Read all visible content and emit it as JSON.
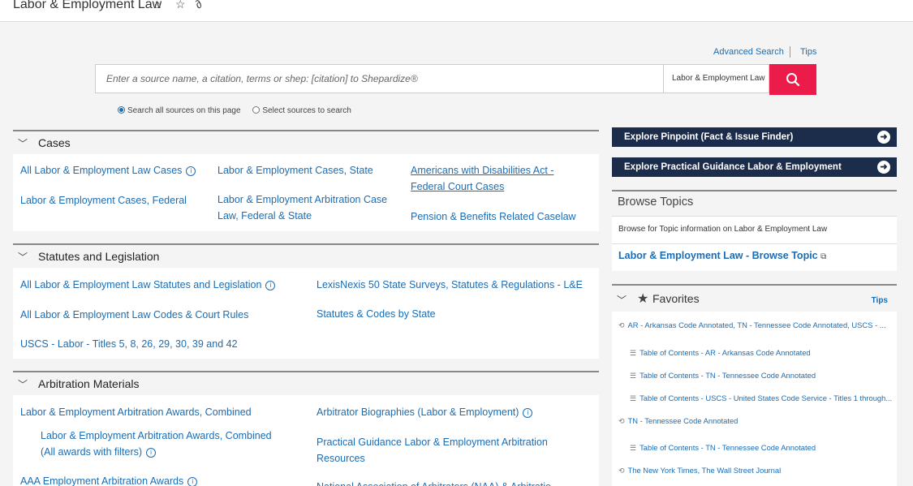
{
  "header": {
    "title": "Labor & Employment Law",
    "icons": [
      "home-icon",
      "star-icon",
      "paperclip-icon"
    ]
  },
  "search": {
    "advanced": "Advanced Search",
    "tips": "Tips",
    "placeholder": "Enter a source name, a citation, terms or shep: [citation] to Shepardize®",
    "scope": "Labor & Employment Law",
    "radio_all": "Search all sources on this page",
    "radio_select": "Select sources to search"
  },
  "cases": {
    "title": "Cases",
    "items": [
      "All Labor & Employment Law Cases",
      "Labor & Employment Cases, Federal",
      "Labor & Employment Cases, State",
      "Labor & Employment Arbitration Case",
      "Law, Federal & State",
      "Americans with Disabilities Act -",
      "Federal Court Cases",
      "Pension & Benefits Related Caselaw"
    ]
  },
  "statutes": {
    "title": "Statutes and Legislation",
    "items": [
      "All Labor & Employment Law Statutes and Legislation",
      "All Labor & Employment Law Codes & Court Rules",
      "USCS - Labor - Titles 5, 8, 26, 29, 30, 39 and 42",
      "LexisNexis 50 State Surveys, Statutes & Regulations - L&E",
      "Statutes & Codes by State"
    ]
  },
  "arbitration": {
    "title": "Arbitration Materials",
    "items": [
      "Labor & Employment Arbitration Awards, Combined",
      "Labor & Employment Arbitration Awards, Combined",
      "(All awards with filters)",
      "AAA Employment Arbitration Awards",
      "Arbitrator Biographies (Labor & Employment)",
      "Practical Guidance Labor & Employment Arbitration",
      "Resources",
      "National Association of Arbitrators (NAA) & Arbitratio"
    ]
  },
  "sidebar": {
    "explore_pinpoint": "Explore Pinpoint (Fact & Issue Finder)",
    "explore_practical": "Explore Practical Guidance Labor & Employment",
    "browse_title": "Browse Topics",
    "browse_desc": "Browse for Topic information on Labor & Employment Law",
    "browse_link": "Labor & Employment Law - Browse Topic",
    "favorites_title": "Favorites",
    "favorites_tips": "Tips",
    "favorites": [
      "AR - Arkansas Code Annotated, TN - Tennessee Code Annotated, USCS - ...",
      "Table of Contents - AR - Arkansas Code Annotated",
      "Table of Contents - TN - Tennessee Code Annotated",
      "Table of Contents - USCS - United States Code Service - Titles 1 through...",
      "TN - Tennessee Code Annotated",
      "Table of Contents - TN - Tennessee Code Annotated",
      "The New York Times, The Wall Street Journal"
    ]
  },
  "colors": {
    "link": "#1a6db5",
    "search_button": "#ec1c4a",
    "nav_button": "#1b2d4a"
  }
}
